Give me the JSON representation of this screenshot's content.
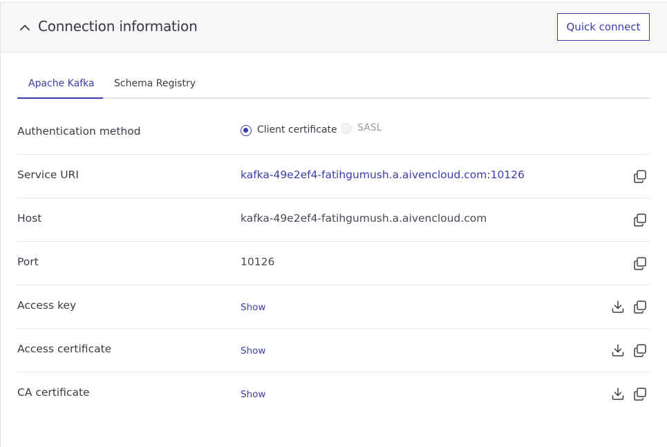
{
  "header": {
    "title": "Connection information",
    "quick_connect_label": "Quick connect",
    "collapse_icon": "chevron-up-icon"
  },
  "tabs": [
    {
      "label": "Apache Kafka",
      "active": true
    },
    {
      "label": "Schema Registry",
      "active": false
    }
  ],
  "auth": {
    "label": "Authentication method",
    "options": [
      {
        "label": "Client certificate",
        "selected": true,
        "disabled": false
      },
      {
        "label": "SASL",
        "selected": false,
        "disabled": true
      }
    ]
  },
  "rows": {
    "service_uri": {
      "label": "Service URI",
      "value": "kafka-49e2ef4-fatihgumush.a.aivencloud.com:10126"
    },
    "host": {
      "label": "Host",
      "value": "kafka-49e2ef4-fatihgumush.a.aivencloud.com"
    },
    "port": {
      "label": "Port",
      "value": "10126"
    },
    "access_key": {
      "label": "Access key",
      "action": "Show"
    },
    "access_certificate": {
      "label": "Access certificate",
      "action": "Show"
    },
    "ca_certificate": {
      "label": "CA certificate",
      "action": "Show"
    }
  },
  "icons": {
    "copy": "copy-icon",
    "download": "download-icon"
  },
  "colors": {
    "accent": "#3a3cab",
    "header_bg": "#f7f7f9",
    "border": "#e6e6ea"
  }
}
